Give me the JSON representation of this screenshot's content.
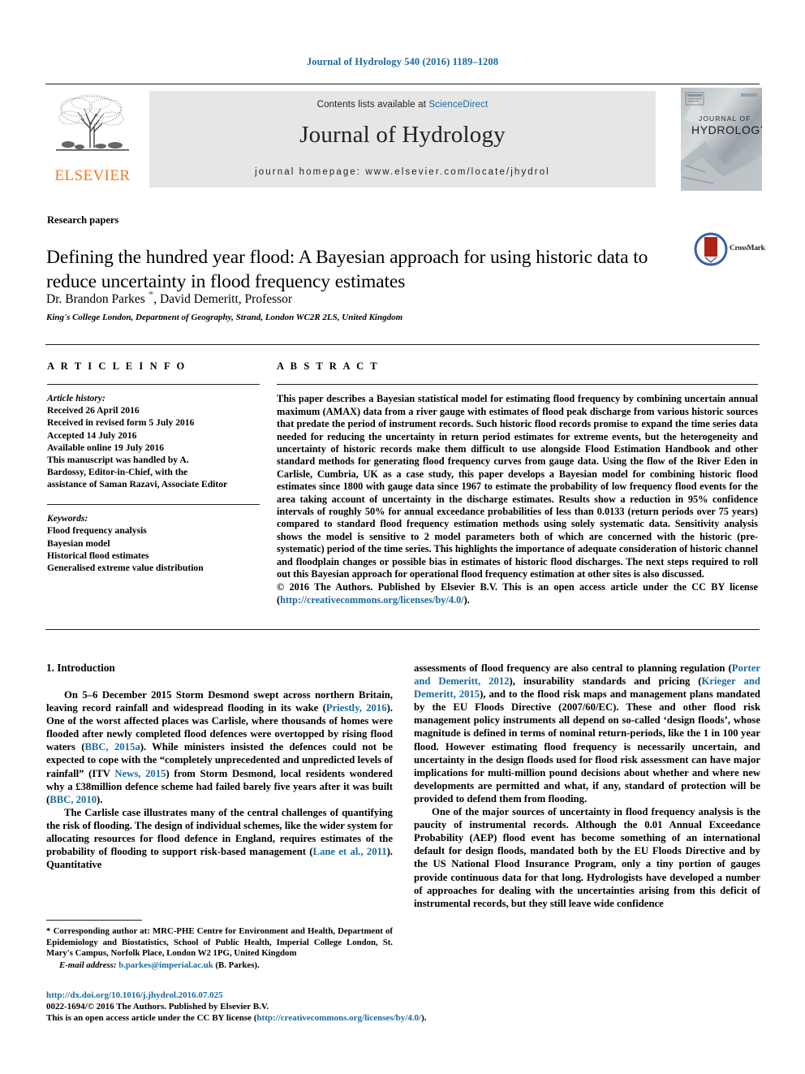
{
  "running_head": "Journal of Hydrology 540 (2016) 1189–1208",
  "masthead": {
    "publisher": "ELSEVIER",
    "contents_prefix": "Contents lists available at ",
    "contents_link": "ScienceDirect",
    "journal_title": "Journal of Hydrology",
    "homepage": "journal homepage: www.elsevier.com/locate/jhydrol",
    "cover_title_line1": "JOURNAL OF",
    "cover_title_line2": "HYDROLOGY"
  },
  "article": {
    "section_label": "Research papers",
    "title": "Defining the hundred year flood: A Bayesian approach for using historic data to reduce uncertainty in flood frequency estimates",
    "crossmark_label": "CrossMark",
    "authors_part1": "Dr. Brandon Parkes ",
    "authors_star": "*",
    "authors_part2": ", David Demeritt, Professor",
    "affiliation": "King's College London, Department of Geography, Strand, London WC2R 2LS, United Kingdom"
  },
  "info": {
    "heading": "A R T I C L E    I N F O",
    "history_label": "Article history:",
    "history": [
      "Received 26 April 2016",
      "Received in revised form 5 July 2016",
      "Accepted 14 July 2016",
      "Available online 19 July 2016",
      "This manuscript was handled by A.",
      "Bardossy, Editor-in-Chief, with the",
      "assistance of Saman Razavi, Associate Editor"
    ],
    "keywords_label": "Keywords:",
    "keywords": [
      "Flood frequency analysis",
      "Bayesian model",
      "Historical flood estimates",
      "Generalised extreme value distribution"
    ]
  },
  "abstract": {
    "heading": "A B S T R A C T",
    "text": "This paper describes a Bayesian statistical model for estimating flood frequency by combining uncertain annual maximum (AMAX) data from a river gauge with estimates of flood peak discharge from various historic sources that predate the period of instrument records. Such historic flood records promise to expand the time series data needed for reducing the uncertainty in return period estimates for extreme events, but the heterogeneity and uncertainty of historic records make them difficult to use alongside Flood Estimation Handbook and other standard methods for generating flood frequency curves from gauge data. Using the flow of the River Eden in Carlisle, Cumbria, UK as a case study, this paper develops a Bayesian model for combining historic flood estimates since 1800 with gauge data since 1967 to estimate the probability of low frequency flood events for the area taking account of uncertainty in the discharge estimates. Results show a reduction in 95% confidence intervals of roughly 50% for annual exceedance probabilities of less than 0.0133 (return periods over 75 years) compared to standard flood frequency estimation methods using solely systematic data. Sensitivity analysis shows the model is sensitive to 2 model parameters both of which are concerned with the historic (pre-systematic) period of the time series. This highlights the importance of adequate consideration of historic channel and floodplain changes or possible bias in estimates of historic flood discharges. The next steps required to roll out this Bayesian approach for operational flood frequency estimation at other sites is also discussed.",
    "copyright_prefix": "© 2016 The Authors. Published by Elsevier B.V. This is an open access article under the CC BY license (",
    "copyright_link": "http://creativecommons.org/licenses/by/4.0/",
    "copyright_suffix": ")."
  },
  "body": {
    "intro_heading": "1. Introduction",
    "left_p1_a": "On 5–6 December 2015 Storm Desmond swept across northern Britain, leaving record rainfall and widespread flooding in its wake (",
    "left_p1_cite1": "Priestly, 2016",
    "left_p1_b": "). One of the worst affected places was Carlisle, where thousands of homes were flooded after newly completed flood defences were overtopped by rising flood waters (",
    "left_p1_cite2": "BBC, 2015a",
    "left_p1_c": "). While ministers insisted the defences could not be expected to cope with the “completely unprecedented and unpredicted levels of rainfall” (ITV ",
    "left_p1_cite3": "News, 2015",
    "left_p1_d": ") from Storm Desmond, local residents wondered why a £38million defence scheme had failed barely five years after it was built (",
    "left_p1_cite4": "BBC, 2010",
    "left_p1_e": ").",
    "left_p2_a": "The Carlisle case illustrates many of the central challenges of quantifying the risk of flooding. The design of individual schemes, like the wider system for allocating resources for flood defence in England, requires estimates of the probability of flooding to support risk-based management (",
    "left_p2_cite1": "Lane et al., 2011",
    "left_p2_b": "). Quantitative",
    "right_p1_a": "assessments of flood frequency are also central to planning regulation (",
    "right_p1_cite1": "Porter and Demeritt, 2012",
    "right_p1_b": "), insurability standards and pricing (",
    "right_p1_cite2": "Krieger and Demeritt, 2015",
    "right_p1_c": "), and to the flood risk maps and management plans mandated by the EU Floods Directive (2007/60/EC). These and other flood risk management policy instruments all depend on so-called ‘design floods’, whose magnitude is defined in terms of nominal return-periods, like the 1 in 100 year flood. However estimating flood frequency is necessarily uncertain, and uncertainty in the design floods used for flood risk assessment can have major implications for multi-million pound decisions about whether and where new developments are permitted and what, if any, standard of protection will be provided to defend them from flooding.",
    "right_p2": "One of the major sources of uncertainty in flood frequency analysis is the paucity of instrumental records. Although the 0.01 Annual Exceedance Probability (AEP) flood event has become something of an international default for design floods, mandated both by the EU Floods Directive and by the US National Flood Insurance Program, only a tiny portion of gauges provide continuous data for that long. Hydrologists have developed a number of approaches for dealing with the uncertainties arising from this deficit of instrumental records, but they still leave wide confidence"
  },
  "footnote": {
    "text": "* Corresponding author at: MRC-PHE Centre for Environment and Health, Department of Epidemiology and Biostatistics, School of Public Health, Imperial College London, St. Mary's Campus, Norfolk Place, London W2 1PG, United Kingdom",
    "email_label": "E-mail address:",
    "email": "b.parkes@imperial.ac.uk",
    "email_suffix": "(B. Parkes)."
  },
  "page_footer": {
    "doi": "http://dx.doi.org/10.1016/j.jhydrol.2016.07.025",
    "issn_line": "0022-1694/© 2016 The Authors. Published by Elsevier B.V.",
    "license_prefix": "This is an open access article under the CC BY license (",
    "license_link": "http://creativecommons.org/licenses/by/4.0/",
    "license_suffix": ")."
  },
  "colors": {
    "link": "#1a6aa0",
    "elsevier_orange": "#ec7c26",
    "band_gray": "#e6e6e6",
    "crossmark_red": "#b02318",
    "crossmark_blue": "#3a5fa8"
  }
}
